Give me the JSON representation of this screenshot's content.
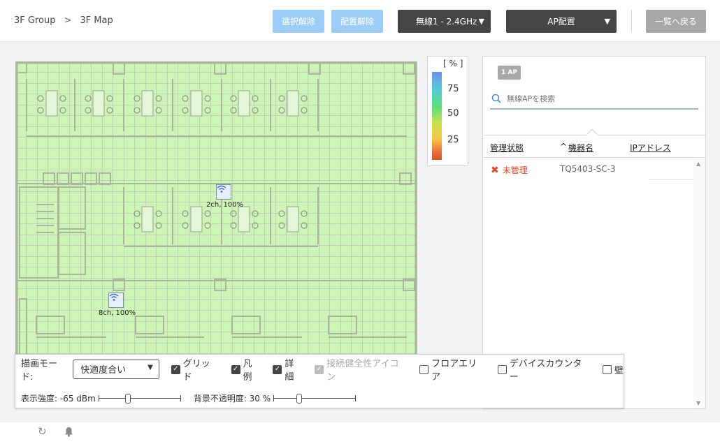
{
  "breadcrumb": {
    "group": "3F Group",
    "sep": ">",
    "map": "3F Map"
  },
  "toolbar": {
    "deselect": "選択解除",
    "unplace": "配置解除",
    "radio": "無線1 - 2.4GHz",
    "ap_place": "AP配置",
    "back_to_list": "一覧へ戻る"
  },
  "map": {
    "aps": [
      {
        "label": "2ch, 100%"
      },
      {
        "label": "8ch, 100%"
      }
    ]
  },
  "legend": {
    "unit": "[ % ]",
    "ticks": [
      "75",
      "50",
      "25"
    ]
  },
  "ap_panel": {
    "count_badge": "1 AP",
    "search_placeholder": "無線APを検索",
    "columns": {
      "status": "管理状態",
      "device_name": "機器名",
      "ip": "IPアドレス",
      "sort_indicator": "^"
    },
    "rows": [
      {
        "status": "未管理",
        "device_name": "TQ5403-SC-3"
      }
    ]
  },
  "controls": {
    "draw_mode_label": "描画モード:",
    "draw_mode_value": "快適度合い",
    "checkboxes": [
      {
        "label": "グリッド",
        "checked": true
      },
      {
        "label": "凡例",
        "checked": true
      },
      {
        "label": "詳細",
        "checked": true
      },
      {
        "label": "接続健全性アイコン",
        "checked": true,
        "disabled": true
      },
      {
        "label": "フロアエリア",
        "checked": false
      },
      {
        "label": "デバイスカウンター",
        "checked": false
      },
      {
        "label": "壁",
        "checked": false
      }
    ],
    "strength_label": "表示強度: -65 dBm",
    "strength_level": 0.35,
    "opacity_label": "背景不透明度: 30 %",
    "opacity_level": 0.3
  },
  "colors": {
    "accent_light": "#9ccdf6",
    "heat_green": "#cdf5b6",
    "error": "#e04a2a"
  },
  "footer": {
    "icons": [
      "refresh-icon",
      "bell-icon"
    ]
  }
}
